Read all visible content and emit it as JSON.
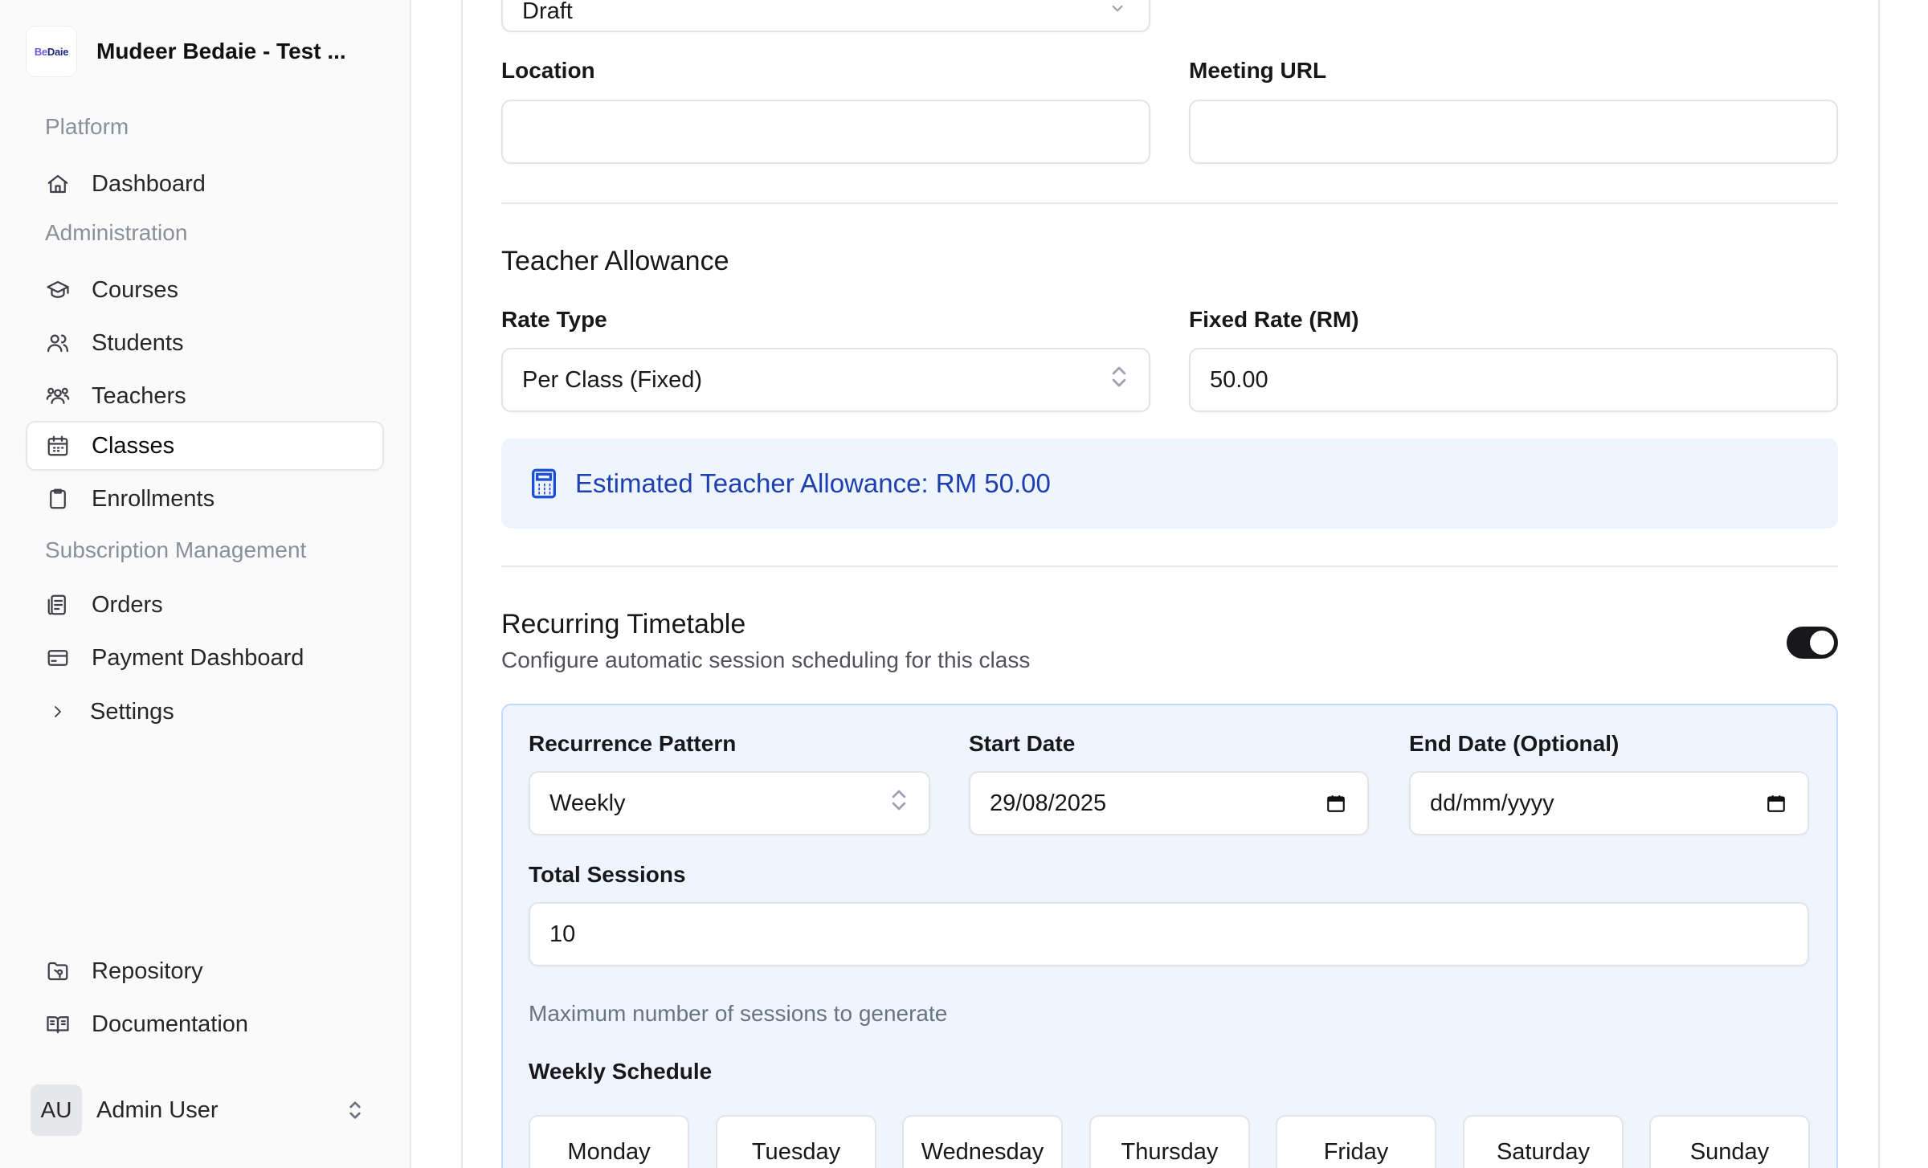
{
  "sidebar": {
    "brand": {
      "logo_text_be": "Be",
      "logo_text_rest": "Daie",
      "name": "Mudeer Bedaie - Test ..."
    },
    "sections": {
      "platform": "Platform",
      "administration": "Administration",
      "subscription": "Subscription Management"
    },
    "items": {
      "dashboard": "Dashboard",
      "courses": "Courses",
      "students": "Students",
      "teachers": "Teachers",
      "classes": "Classes",
      "enrollments": "Enrollments",
      "orders": "Orders",
      "payment_dashboard": "Payment Dashboard",
      "settings": "Settings",
      "repository": "Repository",
      "documentation": "Documentation"
    },
    "active_item": "Classes",
    "user": {
      "initials": "AU",
      "name": "Admin User"
    }
  },
  "form": {
    "status_value": "Draft",
    "location": {
      "label": "Location",
      "value": ""
    },
    "meeting_url": {
      "label": "Meeting URL",
      "value": ""
    },
    "teacher_allowance": {
      "heading": "Teacher Allowance",
      "rate_type_label": "Rate Type",
      "rate_type_value": "Per Class (Fixed)",
      "fixed_rate_label": "Fixed Rate (RM)",
      "fixed_rate_value": "50.00",
      "estimate_text": "Estimated Teacher Allowance: RM 50.00"
    },
    "recurring": {
      "heading": "Recurring Timetable",
      "subtext": "Configure automatic session scheduling for this class",
      "enabled": true,
      "pattern_label": "Recurrence Pattern",
      "pattern_value": "Weekly",
      "start_date_label": "Start Date",
      "start_date_value": "29/08/2025",
      "end_date_label": "End Date (Optional)",
      "end_date_placeholder": "dd/mm/yyyy",
      "total_sessions_label": "Total Sessions",
      "total_sessions_value": "10",
      "total_sessions_help": "Maximum number of sessions to generate",
      "weekly_schedule_label": "Weekly Schedule",
      "days": [
        "Monday",
        "Tuesday",
        "Wednesday",
        "Thursday",
        "Friday",
        "Saturday",
        "Sunday"
      ]
    }
  },
  "colors": {
    "accent_blue": "#1e40af",
    "info_bg": "#eef5ff",
    "toggle_on": "#18181b"
  }
}
